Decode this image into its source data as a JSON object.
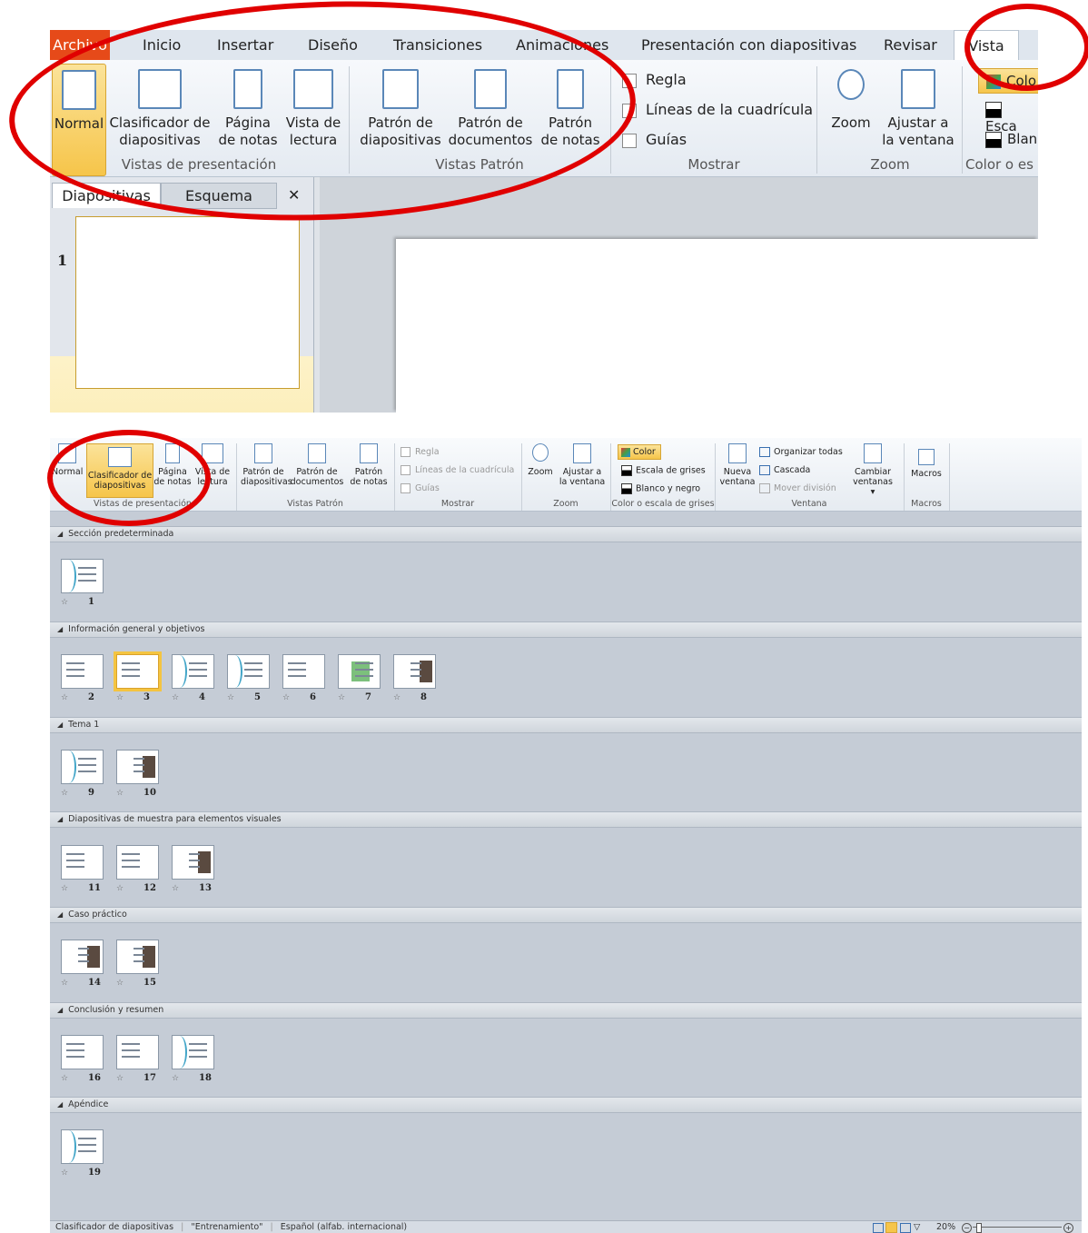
{
  "top": {
    "tabs": [
      "Archivo",
      "Inicio",
      "Insertar",
      "Diseño",
      "Transiciones",
      "Animaciones",
      "Presentación con diapositivas",
      "Revisar",
      "Vista"
    ],
    "buttons": {
      "normal": "Normal",
      "clasificador": [
        "Clasificador de",
        "diapositivas"
      ],
      "pagina": [
        "Página",
        "de notas"
      ],
      "lectura": [
        "Vista de",
        "lectura"
      ],
      "patron_diap": [
        "Patrón de",
        "diapositivas"
      ],
      "patron_doc": [
        "Patrón de",
        "documentos"
      ],
      "patron_notas": [
        "Patrón",
        "de notas"
      ],
      "zoom": "Zoom",
      "ajustar": [
        "Ajustar a",
        "la ventana"
      ]
    },
    "checks": [
      "Regla",
      "Líneas de la cuadrícula",
      "Guías"
    ],
    "color_items": [
      "Colo",
      "Esca",
      "Blan"
    ],
    "groups": [
      "Vistas de presentación",
      "Vistas Patrón",
      "Mostrar",
      "Zoom",
      "Color o es"
    ],
    "panel_tabs": [
      "Diapositivas",
      "Esquema"
    ],
    "close": "✕",
    "slide_number": "1"
  },
  "bottom": {
    "buttons": {
      "normal": "Normal",
      "clasificador": [
        "Clasificador de",
        "diapositivas"
      ],
      "pagina": [
        "Página",
        "de notas"
      ],
      "lectura": [
        "Vista de",
        "lectura"
      ],
      "patron_diap": [
        "Patrón de",
        "diapositivas"
      ],
      "patron_doc": [
        "Patrón de",
        "documentos"
      ],
      "patron_notas": [
        "Patrón",
        "de notas"
      ],
      "zoom": "Zoom",
      "ajustar": [
        "Ajustar a",
        "la ventana"
      ],
      "nueva": [
        "Nueva",
        "ventana"
      ],
      "cambiar": [
        "Cambiar",
        "ventanas ▾"
      ],
      "macros": "Macros"
    },
    "checks": [
      "Regla",
      "Líneas de la cuadrícula",
      "Guías"
    ],
    "color_items": [
      "Color",
      "Escala de grises",
      "Blanco y negro"
    ],
    "window_items": [
      "Organizar todas",
      "Cascada",
      "Mover división"
    ],
    "groups": [
      "Vistas de presentación",
      "Vistas Patrón",
      "Mostrar",
      "Zoom",
      "Color o escala de grises",
      "Ventana",
      "Macros"
    ],
    "sections": [
      {
        "title": "Sección predeterminada",
        "slides": [
          "1"
        ]
      },
      {
        "title": "Información general y objetivos",
        "slides": [
          "2",
          "3",
          "4",
          "5",
          "6",
          "7",
          "8"
        ]
      },
      {
        "title": "Tema 1",
        "slides": [
          "9",
          "10"
        ]
      },
      {
        "title": "Diapositivas de muestra para elementos visuales",
        "slides": [
          "11",
          "12",
          "13"
        ]
      },
      {
        "title": "Caso práctico",
        "slides": [
          "14",
          "15"
        ]
      },
      {
        "title": "Conclusión y resumen",
        "slides": [
          "16",
          "17",
          "18"
        ]
      },
      {
        "title": "Apéndice",
        "slides": [
          "19"
        ]
      }
    ],
    "status": {
      "view": "Clasificador de diapositivas",
      "theme": "\"Entrenamiento\"",
      "language": "Español (alfab. internacional)",
      "zoom": "20%"
    }
  },
  "colors": {
    "accent_file": "#e64a19",
    "selected": "#f6c54a",
    "annotation": "#e00000"
  }
}
